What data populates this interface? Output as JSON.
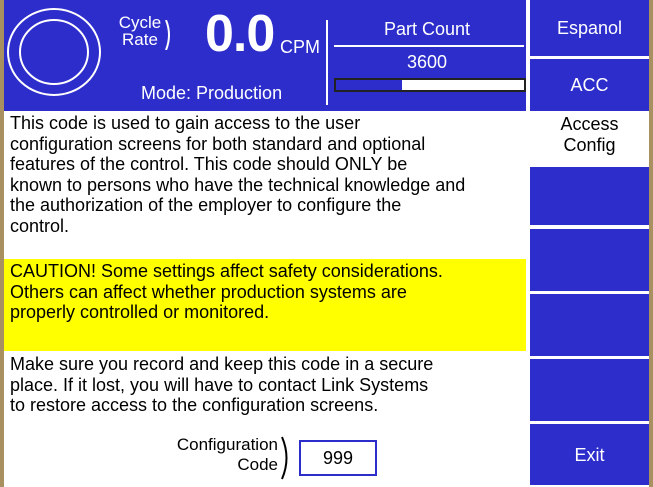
{
  "header": {
    "cycle_rate_label_line1": "Cycle",
    "cycle_rate_label_line2": "Rate",
    "rate_value": "0.0",
    "rate_unit": "CPM",
    "mode": "Mode: Production",
    "part_count_title": "Part Count",
    "part_count_value": "3600",
    "part_count_progress": 0.35
  },
  "side": {
    "language_button": "Espanol",
    "acc_button": "ACC",
    "screen_label_line1": "Access",
    "screen_label_line2": "Config",
    "exit_button": "Exit"
  },
  "body": {
    "intro": "This code is used to gain access to the user\nconfiguration screens for both standard and optional\nfeatures of the control. This code should ONLY be\nknown to persons who have the technical knowledge and\nthe authorization of the employer to configure the\ncontrol.",
    "caution": "CAUTION! Some settings affect safety considerations.\nOthers can affect whether production systems are\nproperly controlled or monitored.",
    "note": "Make sure you record and keep this code in a secure\nplace. If it lost, you will have to contact Link Systems\nto restore access to the configuration screens."
  },
  "config": {
    "label_line1": "Configuration",
    "label_line2": "Code",
    "value": "999"
  },
  "colors": {
    "primary_blue": "#2d2dcc",
    "caution_yellow": "#ffff00",
    "frame": "#a89060"
  }
}
